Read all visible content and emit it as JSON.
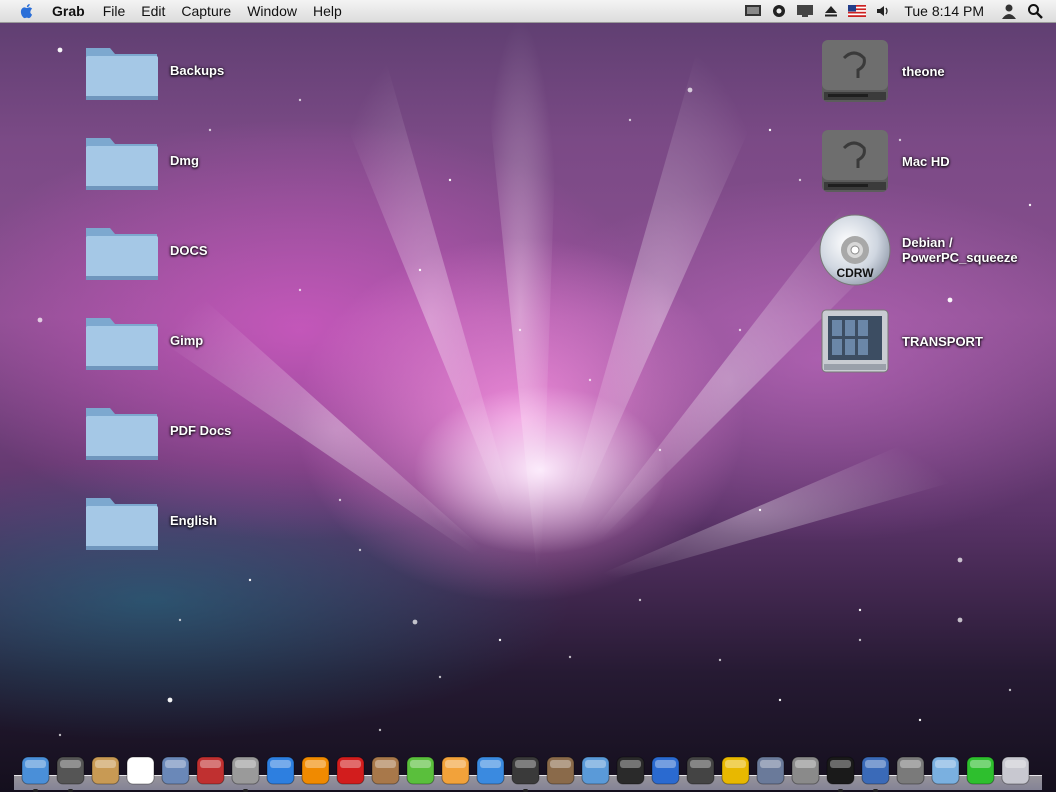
{
  "menubar": {
    "app_name": "Grab",
    "menus": [
      "File",
      "Edit",
      "Capture",
      "Window",
      "Help"
    ],
    "clock": "Tue 8:14 PM",
    "extras": [
      "display-icon",
      "gear-icon",
      "screen-icon",
      "eject-icon",
      "us-flag-icon",
      "volume-icon",
      "user-icon",
      "spotlight-search-icon"
    ]
  },
  "desktop": {
    "folders": [
      {
        "label": "Backups"
      },
      {
        "label": "Dmg"
      },
      {
        "label": "DOCS"
      },
      {
        "label": "Gimp"
      },
      {
        "label": "PDF Docs"
      },
      {
        "label": "English"
      }
    ],
    "volumes": [
      {
        "label": "theone",
        "kind": "hard-drive"
      },
      {
        "label": "Mac HD",
        "kind": "hard-drive"
      },
      {
        "label": "Debian /\nPowerPC_squeeze",
        "kind": "cdrw",
        "disc_text": "CDRW"
      },
      {
        "label": "TRANSPORT",
        "kind": "external-drive"
      }
    ]
  },
  "dock": {
    "apps": [
      {
        "name": "finder-icon",
        "color": "#4a8fd8",
        "running": true
      },
      {
        "name": "dashboard-icon",
        "color": "#555",
        "running": true
      },
      {
        "name": "address-book-icon",
        "color": "#c89a54",
        "running": false
      },
      {
        "name": "ical-icon",
        "color": "#ffffff",
        "running": false
      },
      {
        "name": "iphoto-icon",
        "color": "#6a88b8",
        "running": false
      },
      {
        "name": "scissors-icon",
        "color": "#c03030",
        "running": false
      },
      {
        "name": "grab-icon",
        "color": "#9a9a9a",
        "running": true
      },
      {
        "name": "itunes-icon",
        "color": "#2d7fe0",
        "running": false
      },
      {
        "name": "vlc-icon",
        "color": "#f08a00",
        "running": false
      },
      {
        "name": "acrobat-icon",
        "color": "#d21d1d",
        "running": false
      },
      {
        "name": "preview-icon",
        "color": "#a8784a",
        "running": false
      },
      {
        "name": "lime-icon",
        "color": "#5abf3c",
        "running": false
      },
      {
        "name": "pages-icon",
        "color": "#f2a23a",
        "running": false
      },
      {
        "name": "keynote-icon",
        "color": "#3a8ae0",
        "running": false
      },
      {
        "name": "photo-booth-icon",
        "color": "#3a3a3a",
        "running": true
      },
      {
        "name": "image-editor-icon",
        "color": "#8a6a4a",
        "running": false
      },
      {
        "name": "photo-viewer-icon",
        "color": "#5a9ad8",
        "running": false
      },
      {
        "name": "imovie-icon",
        "color": "#2a2a2a",
        "running": false
      },
      {
        "name": "home-sync-icon",
        "color": "#2a6ad0",
        "running": false
      },
      {
        "name": "drive-utility-icon",
        "color": "#444",
        "running": false
      },
      {
        "name": "radiation-icon",
        "color": "#e8b800",
        "running": false
      },
      {
        "name": "xcode-icon",
        "color": "#6a7a9a",
        "running": false
      },
      {
        "name": "disk-utility-icon",
        "color": "#8a8a8a",
        "running": false
      },
      {
        "name": "terminal-icon",
        "color": "#1a1a1a",
        "running": true
      },
      {
        "name": "split-view-icon",
        "color": "#3a6ab8",
        "running": true
      },
      {
        "name": "system-preferences-icon",
        "color": "#7a7a7a",
        "running": false
      },
      {
        "name": "folder-stack-icon",
        "color": "#7ab0e0",
        "running": false
      },
      {
        "name": "downloads-icon",
        "color": "#2ebf2e",
        "running": false
      },
      {
        "name": "trash-icon",
        "color": "#c8c8d0",
        "running": false
      }
    ]
  }
}
